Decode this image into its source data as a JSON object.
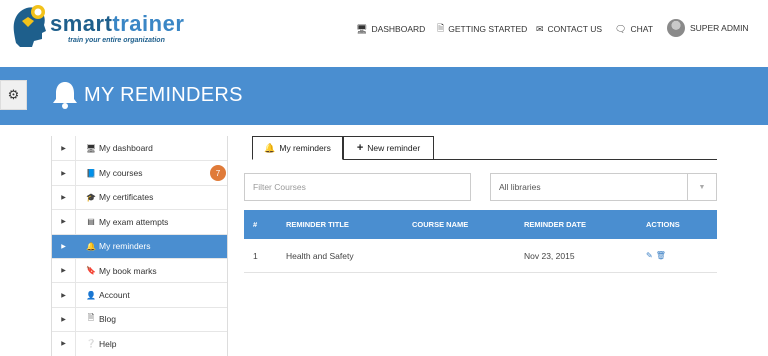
{
  "brand": {
    "name_part1": "smart",
    "name_part2": "trainer",
    "tagline": "train your entire organization"
  },
  "topnav": {
    "dashboard": "DASHBOARD",
    "getting_started": "GETTING STARTED",
    "contact_us": "CONTACT US",
    "chat": "CHAT",
    "user": "SUPER ADMIN"
  },
  "banner": {
    "title": "MY REMINDERS"
  },
  "sidebar": {
    "items": [
      {
        "label": "My dashboard",
        "icon": "monitor-icon"
      },
      {
        "label": "My courses",
        "icon": "book-icon",
        "badge": "7"
      },
      {
        "label": "My certificates",
        "icon": "graduation-cap-icon"
      },
      {
        "label": "My exam attempts",
        "icon": "list-icon"
      },
      {
        "label": "My reminders",
        "icon": "bell-icon",
        "active": true
      },
      {
        "label": "My book marks",
        "icon": "bookmark-icon"
      },
      {
        "label": "Account",
        "icon": "user-icon"
      },
      {
        "label": "Blog",
        "icon": "document-icon"
      },
      {
        "label": "Help",
        "icon": "question-icon"
      }
    ]
  },
  "tabs": {
    "my_reminders": "My reminders",
    "new_reminder": "New reminder"
  },
  "filters": {
    "course_placeholder": "Filter Courses",
    "library_selected": "All libraries"
  },
  "table": {
    "headers": [
      "#",
      "REMINDER TITLE",
      "COURSE NAME",
      "REMINDER DATE",
      "ACTIONS"
    ],
    "rows": [
      {
        "num": "1",
        "title": "Health and Safety",
        "course": "",
        "date": "Nov 23, 2015"
      }
    ]
  },
  "colors": {
    "primary": "#4a8ed0",
    "badge": "#e07b39",
    "brand_dark": "#1e5f8c"
  }
}
